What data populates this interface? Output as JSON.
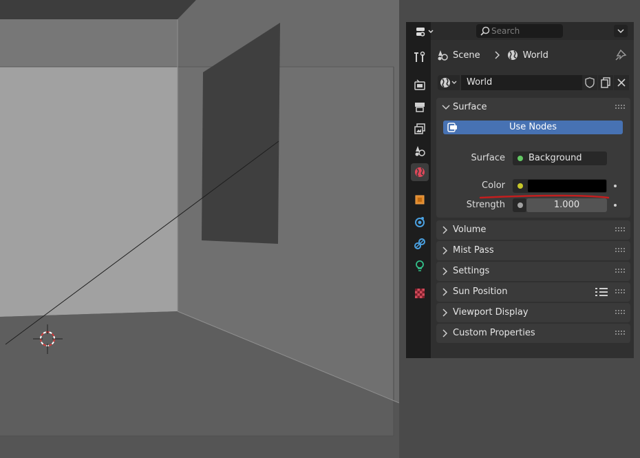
{
  "header": {
    "editor_type_icon": "properties-editor-icon",
    "search_placeholder": "Search"
  },
  "tabs": [
    {
      "name": "tool-tab",
      "icon": "tool-icon"
    },
    {
      "name": "render-tab",
      "icon": "render-icon"
    },
    {
      "name": "output-tab",
      "icon": "output-icon"
    },
    {
      "name": "view-layer-tab",
      "icon": "view-layer-icon"
    },
    {
      "name": "scene-tab",
      "icon": "scene-icon"
    },
    {
      "name": "world-tab",
      "icon": "world-icon",
      "active": true
    },
    {
      "name": "object-tab",
      "icon": "object-icon"
    },
    {
      "name": "physics-tab",
      "icon": "physics-icon"
    },
    {
      "name": "constraints-tab",
      "icon": "constraints-icon"
    },
    {
      "name": "object-data-tab",
      "icon": "light-icon"
    },
    {
      "name": "texture-tab",
      "icon": "texture-icon"
    }
  ],
  "breadcrumb": {
    "scene": "Scene",
    "world": "World"
  },
  "id_block": {
    "name": "World"
  },
  "surface": {
    "title": "Surface",
    "use_nodes_label": "Use Nodes",
    "surface_label": "Surface",
    "surface_value": "Background",
    "color_label": "Color",
    "color_value": "#000000",
    "strength_label": "Strength",
    "strength_value": "1.000"
  },
  "panels": [
    {
      "title": "Volume"
    },
    {
      "title": "Mist Pass"
    },
    {
      "title": "Settings"
    },
    {
      "title": "Sun Position"
    },
    {
      "title": "Viewport Display"
    },
    {
      "title": "Custom Properties"
    }
  ],
  "colors": {
    "accent_blue": "#4772b3",
    "socket_green": "#63c763",
    "socket_yellow": "#c7c729",
    "socket_gray": "#a1a1a1",
    "annotation_red": "#c41e1e"
  }
}
